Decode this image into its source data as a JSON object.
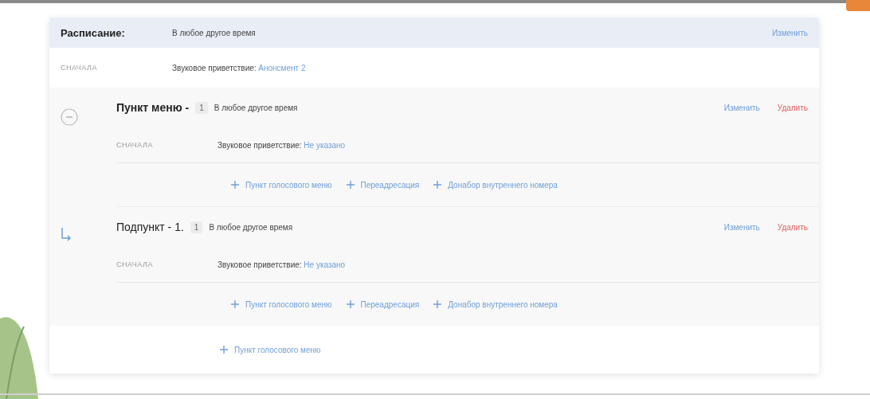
{
  "schedule": {
    "label": "Расписание:",
    "value": "В любое другое время",
    "edit": "Изменить"
  },
  "first": {
    "label": "СНАЧАЛА",
    "greeting_label": "Звуковое приветствие:",
    "greeting_value": "Анонсмент 2"
  },
  "items": [
    {
      "kind": "menu",
      "title": "Пункт меню -",
      "number": "1",
      "time": "В любое другое время",
      "edit": "Изменить",
      "delete": "Удалить",
      "first_label": "СНАЧАЛА",
      "greeting_label": "Звуковое приветствие:",
      "greeting_value": "Не указано",
      "actions": [
        "Пункт голосового меню",
        "Переадресация",
        "Донабор внутреннего номера"
      ]
    },
    {
      "kind": "subitem",
      "title": "Подпункт - 1.",
      "number": "1",
      "time": "В любое другое время",
      "edit": "Изменить",
      "delete": "Удалить",
      "first_label": "СНАЧАЛА",
      "greeting_label": "Звуковое приветствие:",
      "greeting_value": "Не указано",
      "actions": [
        "Пункт голосового меню",
        "Переадресация",
        "Донабор внутреннего номера"
      ]
    }
  ],
  "add_action": "Пункт голосового меню"
}
